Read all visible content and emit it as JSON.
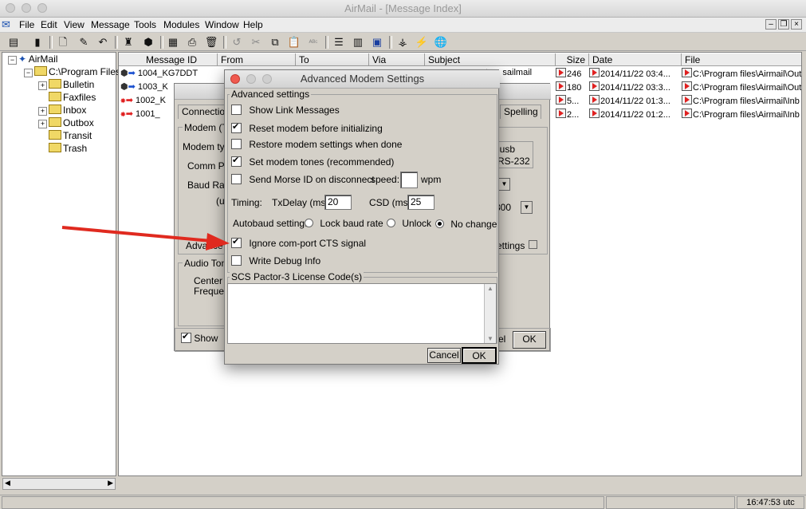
{
  "app": {
    "title": "AirMail - [Message Index]"
  },
  "menu": [
    "File",
    "Edit",
    "View",
    "Message",
    "Tools",
    "Modules",
    "Window",
    "Help"
  ],
  "tree": {
    "root": "AirMail",
    "path": "C:\\Program Files\\",
    "folders": [
      "Bulletin",
      "Faxfiles",
      "Inbox",
      "Outbox",
      "Transit",
      "Trash"
    ]
  },
  "columns": [
    "Message ID",
    "From",
    "To",
    "Via",
    "Subject",
    "Size",
    "Date",
    "File"
  ],
  "messages": [
    {
      "id": "1004_KG7DDT",
      "subject": "t on sailmail",
      "size": "246",
      "date": "2014/11/22 03:4...",
      "file": "C:\\Program files\\Airmail\\Out"
    },
    {
      "id": "1003_K",
      "subject": "",
      "size": "180",
      "date": "2014/11/22 03:3...",
      "file": "C:\\Program files\\Airmail\\Out"
    },
    {
      "id": "1002_K",
      "subject": "",
      "size": "5...",
      "date": "2014/11/22 01:3...",
      "file": "C:\\Program files\\Airmail\\Inb"
    },
    {
      "id": "1001_",
      "subject": "",
      "size": "2...",
      "date": "2014/11/22 01:2...",
      "file": "C:\\Program files\\Airmail\\Inb"
    }
  ],
  "status": {
    "time": "16:47:53 utc"
  },
  "bg_dialog": {
    "tab_connection": "Connection",
    "tab_spelling": "Spelling",
    "modem_group": "Modem (T",
    "modem_type": "Modem typ",
    "comm_port": "Comm Po",
    "baud_rate": "Baud Rat",
    "u_label": "(u",
    "usb_text": "iusb",
    "rs232_text": "RS-232",
    "baud_value": "800",
    "advanced": "Advance",
    "settings_label": "ettings",
    "audio_group": "Audio Ton",
    "center": "Center",
    "frequen": "Frequen",
    "show": "Show",
    "cancel_partial": "el",
    "ok": "OK"
  },
  "dialog": {
    "title": "Advanced Modem Settings",
    "group_label": "Advanced settings",
    "options": [
      {
        "label": "Show Link Messages",
        "checked": false
      },
      {
        "label": "Reset modem before initializing",
        "checked": true
      },
      {
        "label": "Restore modem settings when done",
        "checked": false
      },
      {
        "label": "Set modem tones (recommended)",
        "checked": true
      },
      {
        "label": "Send Morse ID on disconnect",
        "checked": false
      }
    ],
    "speed_label": "speed:",
    "wpm_label": "wpm",
    "timing_label": "Timing:",
    "txdelay_label": "TxDelay (ms):",
    "txdelay_value": "20",
    "csd_label": "CSD (ms):",
    "csd_value": "25",
    "autobaud_label": "Autobaud setting:",
    "autobaud_options": [
      "Lock baud rate",
      "Unlock",
      "No change"
    ],
    "autobaud_selected": "No change",
    "ignore_cts": {
      "label": "Ignore com-port CTS signal",
      "checked": true
    },
    "debug": {
      "label": "Write Debug Info",
      "checked": false
    },
    "license_label": "SCS Pactor-3 License Code(s)",
    "cancel": "Cancel",
    "ok": "OK"
  },
  "colors": {
    "arrow": "#e02a1f",
    "window_bg": "#d4d0c8"
  }
}
